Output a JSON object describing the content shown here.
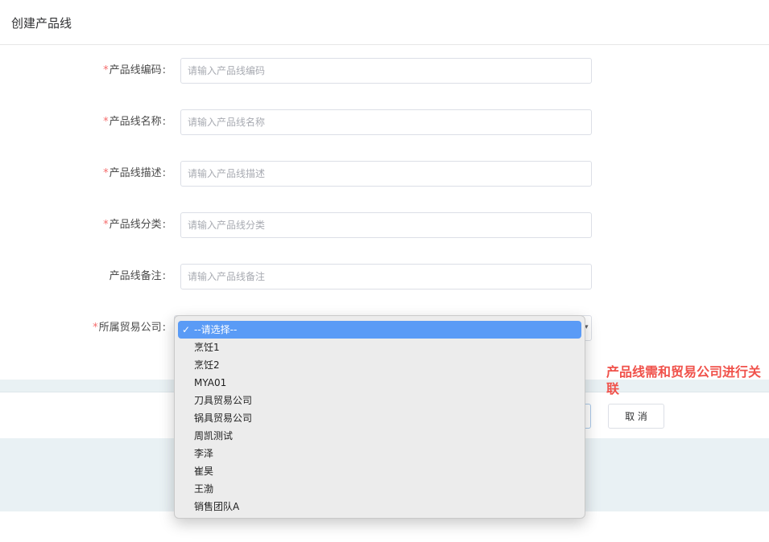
{
  "header": {
    "title": "创建产品线"
  },
  "form": {
    "required_mark": "*",
    "colon": ":",
    "fields": [
      {
        "label": "产品线编码",
        "placeholder": "请输入产品线编码",
        "value": ""
      },
      {
        "label": "产品线名称",
        "placeholder": "请输入产品线名称",
        "value": ""
      },
      {
        "label": "产品线描述",
        "placeholder": "请输入产品线描述",
        "value": ""
      },
      {
        "label": "产品线分类",
        "placeholder": "请输入产品线分类",
        "value": ""
      },
      {
        "label": "产品线备注",
        "placeholder": "请输入产品线备注",
        "value": ""
      }
    ],
    "company_select": {
      "label": "所属贸易公司",
      "selected": "--请选择--",
      "options": [
        "--请选择--",
        "烹饪1",
        "烹饪2",
        "MYA01",
        "刀具贸易公司",
        "锅具贸易公司",
        "周凯测试",
        "李泽",
        "崔昊",
        "王渤",
        "销售团队A"
      ],
      "check_icon": "checkmark-icon",
      "arrow_icon": "chevron-down-icon"
    }
  },
  "footer": {
    "cancel_label": "取 消"
  },
  "annotation": {
    "text": "产品线需和贸易公司进行关联",
    "color": "#f0524b"
  },
  "colors": {
    "required": "#f56c6c",
    "selected_option": "#5a9bf6",
    "band": "#e9f1f4"
  }
}
